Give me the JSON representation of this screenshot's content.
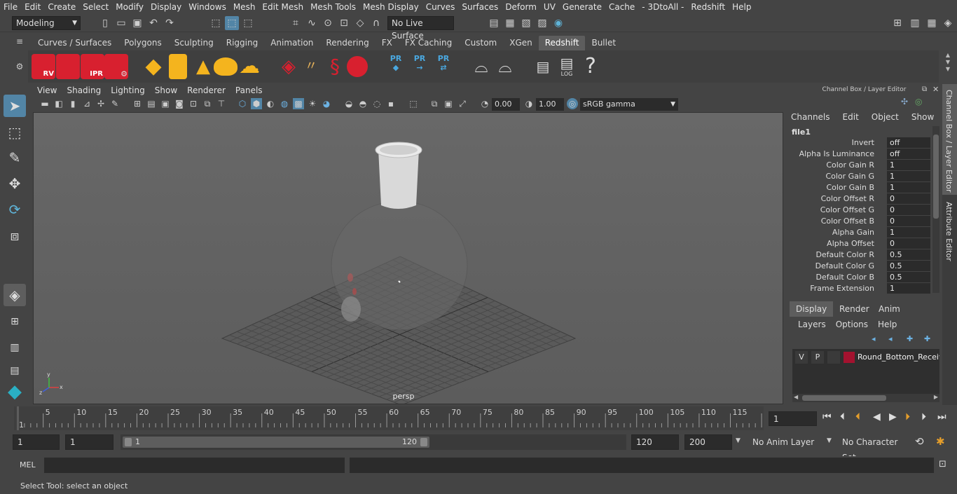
{
  "menubar": {
    "items": [
      "File",
      "Edit",
      "Create",
      "Select",
      "Modify",
      "Display",
      "Windows",
      "Mesh",
      "Edit Mesh",
      "Mesh Tools",
      "Mesh Display",
      "Curves",
      "Surfaces",
      "Deform",
      "UV",
      "Generate",
      "Cache",
      "- 3DtoAll -",
      "Redshift",
      "Help"
    ]
  },
  "statusline": {
    "mode": "Modeling",
    "live_surface": "No Live Surface"
  },
  "shelf": {
    "tabs": [
      "Curves / Surfaces",
      "Polygons",
      "Sculpting",
      "Rigging",
      "Animation",
      "Rendering",
      "FX",
      "FX Caching",
      "Custom",
      "XGen",
      "Redshift",
      "Bullet"
    ],
    "active_tab": "Redshift",
    "rs_labels": [
      "RV",
      "IPR",
      "PR",
      "PR",
      "PR",
      "LOG",
      "?"
    ]
  },
  "viewport": {
    "menus": [
      "View",
      "Shading",
      "Lighting",
      "Show",
      "Renderer",
      "Panels"
    ],
    "exposure": "0.00",
    "gamma": "1.00",
    "color_space": "sRGB gamma",
    "camera_label": "persp",
    "axis_x": "x",
    "axis_y": "y",
    "axis_z": "z"
  },
  "channelbox": {
    "title": "Channel Box / Layer Editor",
    "menus": [
      "Channels",
      "Edit",
      "Object",
      "Show"
    ],
    "node": "file1",
    "attributes": [
      {
        "label": "Invert",
        "value": "off"
      },
      {
        "label": "Alpha Is Luminance",
        "value": "off"
      },
      {
        "label": "Color Gain R",
        "value": "1"
      },
      {
        "label": "Color Gain G",
        "value": "1"
      },
      {
        "label": "Color Gain B",
        "value": "1"
      },
      {
        "label": "Color Offset R",
        "value": "0"
      },
      {
        "label": "Color Offset G",
        "value": "0"
      },
      {
        "label": "Color Offset B",
        "value": "0"
      },
      {
        "label": "Alpha Gain",
        "value": "1"
      },
      {
        "label": "Alpha Offset",
        "value": "0"
      },
      {
        "label": "Default Color R",
        "value": "0.5"
      },
      {
        "label": "Default Color G",
        "value": "0.5"
      },
      {
        "label": "Default Color B",
        "value": "0.5"
      },
      {
        "label": "Frame Extension",
        "value": "1"
      }
    ]
  },
  "layereditor": {
    "tabs": [
      "Display",
      "Render",
      "Anim"
    ],
    "active_tab": "Display",
    "menus": [
      "Layers",
      "Options",
      "Help"
    ],
    "layer": {
      "v": "V",
      "p": "P",
      "name": "Round_Bottom_Receiv",
      "color": "#a3122f"
    }
  },
  "sidetabs": {
    "channel_box": "Channel Box / Layer Editor",
    "attribute_editor": "Attribute Editor"
  },
  "timeline": {
    "ticks": [
      "1",
      "5",
      "10",
      "15",
      "20",
      "25",
      "30",
      "35",
      "40",
      "45",
      "50",
      "55",
      "60",
      "65",
      "70",
      "75",
      "80",
      "85",
      "90",
      "95",
      "100",
      "105",
      "110",
      "115",
      "12"
    ],
    "current_frame": "1"
  },
  "range": {
    "start": "1",
    "playback_start": "1",
    "slider_start": "1",
    "slider_end": "120",
    "playback_end": "120",
    "end": "200",
    "anim_layer": "No Anim Layer",
    "character_set": "No Character Set"
  },
  "cmdline": {
    "label": "MEL"
  },
  "helpline": {
    "text": "Select Tool: select an object"
  },
  "colors": {
    "accent": "#5285a6",
    "redshift_red": "#d8202f",
    "layer_color": "#a3122f"
  }
}
